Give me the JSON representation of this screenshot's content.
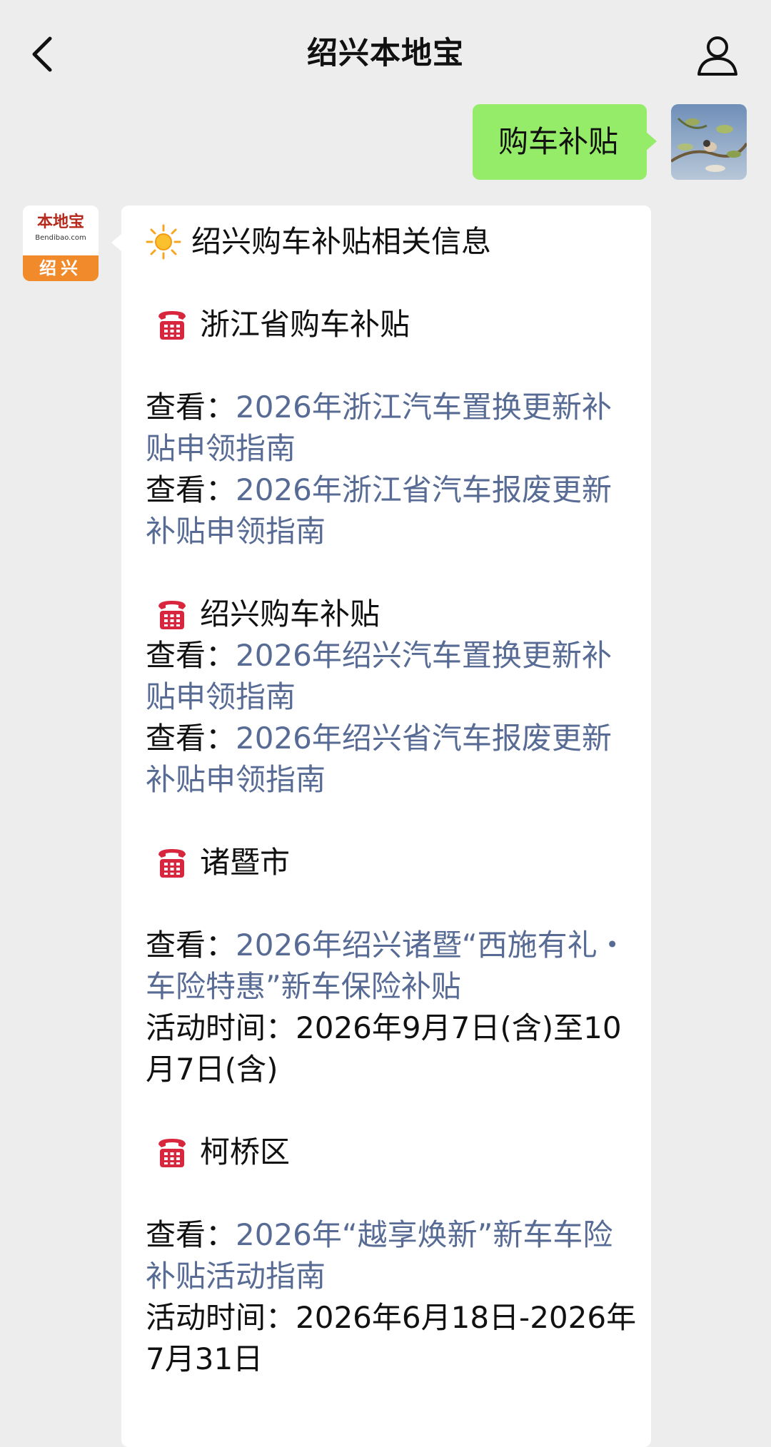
{
  "nav": {
    "title": "绍兴本地宝"
  },
  "chat": {
    "sent_message": "购车补贴",
    "bot_avatar": {
      "brand": "本地宝",
      "brand_url": "Bendibao.com",
      "city": "绍兴"
    },
    "reply": {
      "title": "绍兴购车补贴相关信息",
      "sections": [
        {
          "heading": "浙江省购车补贴",
          "items": [
            {
              "prefix": "查看：",
              "link": "2026年浙江汽车置换更新补贴申领指南"
            },
            {
              "prefix": "查看：",
              "link": "2026年浙江省汽车报废更新补贴申领指南"
            }
          ]
        },
        {
          "heading": "绍兴购车补贴",
          "items": [
            {
              "prefix": "查看：",
              "link": "2026年绍兴汽车置换更新补贴申领指南"
            },
            {
              "prefix": "查看：",
              "link": "2026年绍兴省汽车报废更新补贴申领指南"
            }
          ]
        },
        {
          "heading": "诸暨市",
          "items": [
            {
              "prefix": "查看：",
              "link": "2026年绍兴诸暨“西施有礼・车险特惠”新车保险补贴"
            }
          ],
          "note": "活动时间：2026年9月7日(含)至10月7日(含)"
        },
        {
          "heading": "柯桥区",
          "items": [
            {
              "prefix": "查看：",
              "link": "2026年“越享焕新”新车车险补贴活动指南"
            }
          ],
          "note": "活动时间：2026年6月18日-2026年7月31日"
        }
      ]
    }
  },
  "icons": {
    "back": "chevron-left-icon",
    "profile": "person-icon",
    "sun": "sun-icon",
    "phone": "telephone-icon"
  },
  "colors": {
    "background": "#ededed",
    "sent_bubble": "#95ec69",
    "link": "#576b95",
    "phone_icon": "#d7263d",
    "city_badge": "#f08a2a"
  }
}
